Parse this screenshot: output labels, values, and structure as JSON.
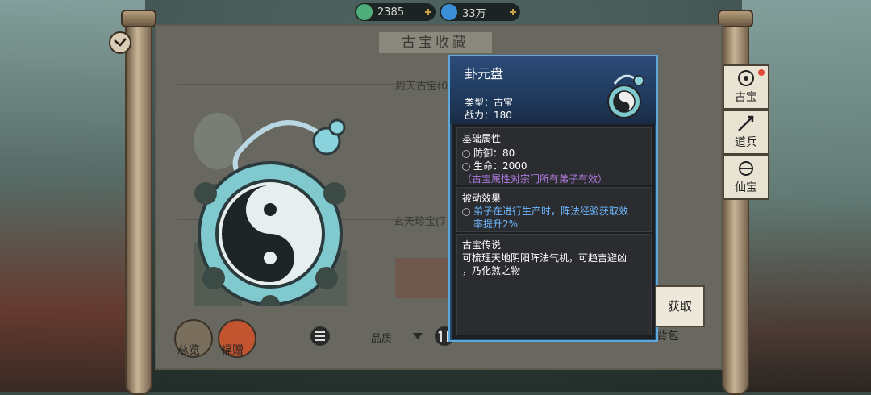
{
  "resources": [
    {
      "icon": "jade-coin-icon",
      "value": "2385",
      "color": "#4fae7a"
    },
    {
      "icon": "water-drop-icon",
      "value": "33万",
      "color": "#3a8fd6"
    }
  ],
  "panel": {
    "title": "古宝收藏",
    "sections": [
      {
        "label": "周天古宝(0"
      },
      {
        "label": "玄天珍宝(7"
      }
    ],
    "item_label_fragment": "卦"
  },
  "side_tabs": [
    {
      "label": "古宝",
      "icon": "ancient-treasure-icon"
    },
    {
      "label": "道兵",
      "icon": "weapon-icon"
    },
    {
      "label": "仙宝",
      "icon": "immortal-treasure-icon"
    }
  ],
  "bottom_bar": {
    "overview_label": "总览",
    "blessing_label": "福赠",
    "filter_label": "品质",
    "bag_label": "背包"
  },
  "tooltip": {
    "name": "卦元盘",
    "type_line": "类型：古宝",
    "power_line": "战力：180",
    "base_attr": {
      "header": "基础属性",
      "rows": [
        "防御：80",
        "生命：2000"
      ],
      "note": "（古宝属性对宗门所有弟子有效）"
    },
    "passive": {
      "header": "被动效果",
      "line1": "弟子在进行生产时，阵法经验获取效",
      "line2": "率提升2%"
    },
    "lore": {
      "header": "古宝传说",
      "line1": "可梳理天地阴阳阵法气机，可趋吉避凶",
      "line2": "，乃化煞之物"
    }
  },
  "get_button": "获取",
  "colors": {
    "tooltip_border": "#5fa8de",
    "passive_text": "#6eb7ff",
    "note_text": "#b07ae0"
  }
}
